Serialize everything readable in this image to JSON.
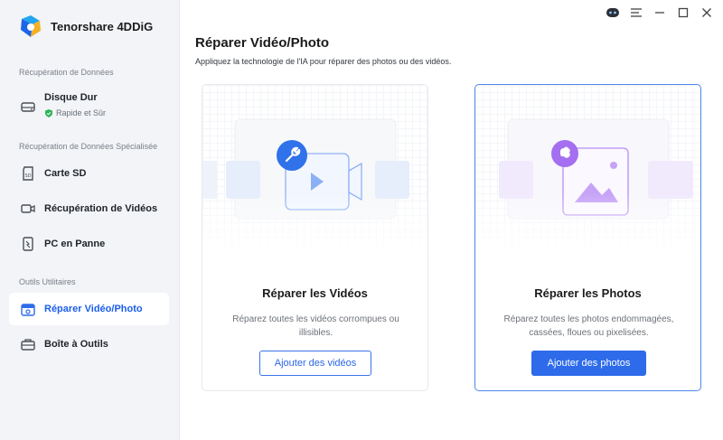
{
  "app": {
    "name": "Tenorshare 4DDiG"
  },
  "sidebar": {
    "sections": [
      {
        "label": "Récupération de Données"
      },
      {
        "label": "Récupération de Données Spécialisée"
      },
      {
        "label": "Outils Utilitaires"
      }
    ],
    "items": [
      {
        "label": "Disque Dur",
        "sub": "Rapide et Sûr",
        "icon": "hard-drive-icon"
      },
      {
        "label": "Carte SD",
        "icon": "sd-card-icon"
      },
      {
        "label": "Récupération de Vidéos",
        "icon": "video-icon"
      },
      {
        "label": "PC en Panne",
        "icon": "crashed-pc-icon"
      },
      {
        "label": "Réparer Vidéo/Photo",
        "icon": "repair-icon",
        "active": true
      },
      {
        "label": "Boîte à Outils",
        "icon": "toolbox-icon"
      }
    ]
  },
  "main": {
    "title": "Réparer Vidéo/Photo",
    "subtitle": "Appliquez la technologie de l'IA pour réparer des photos ou des vidéos.",
    "cards": [
      {
        "title": "Réparer les Vidéos",
        "description": "Réparez toutes les vidéos corrompues ou illisibles.",
        "button": "Ajouter des vidéos"
      },
      {
        "title": "Réparer les Photos",
        "description": "Réparez toutes les photos endommagées, cassées, floues ou pixelisées.",
        "button": "Ajouter des photos",
        "selected": true
      }
    ]
  },
  "colors": {
    "accent": "#2d6bea",
    "sidebar_bg": "#f2f4f7",
    "photo_purple": "#a46ff0",
    "video_blue": "#2f72ea"
  }
}
